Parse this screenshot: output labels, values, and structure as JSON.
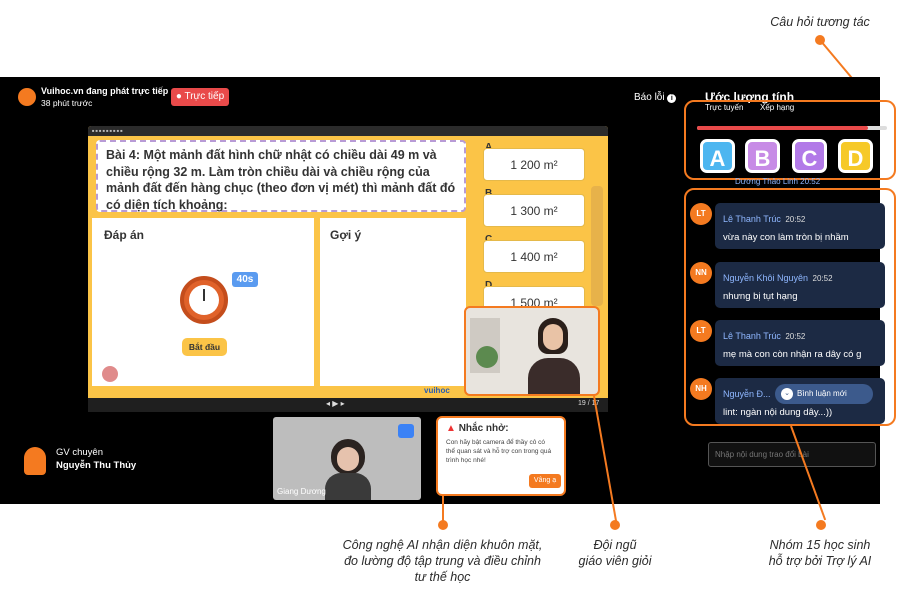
{
  "callouts": {
    "top_right": "Câu hỏi tương tác",
    "bottom_left": [
      "Công nghệ AI nhận diện khuôn mặt,",
      "đo lường độ tập trung và điều chỉnh",
      "tư thế học"
    ],
    "bottom_mid": [
      "Đội ngũ",
      "giáo viên giỏi"
    ],
    "bottom_right": [
      "Nhóm 15 học sinh",
      "hỗ trợ bởi Trợ lý AI"
    ]
  },
  "header": {
    "channel": "Vuihoc.vn đang phát trực tiếp",
    "time_ago": "38 phút trước",
    "live_label": "Trực tiếp",
    "report_label": "Báo lỗi",
    "panel_title": "Ước lượng tính"
  },
  "slide": {
    "question": "Bài 4: Một mảnh đất hình chữ nhật có chiều dài 49 m và chiều rộng 32 m. Làm tròn chiều dài và chiều rộng của mảnh đất đến hàng chục (theo đơn vị mét) thì mảnh đất đó có diện tích khoảng:",
    "answers": [
      {
        "letter": "A",
        "value": "1 200 m²"
      },
      {
        "letter": "B",
        "value": "1 300 m²"
      },
      {
        "letter": "C",
        "value": "1 400 m²"
      },
      {
        "letter": "D",
        "value": "1 500 m²"
      }
    ],
    "answer_panel_title": "Đáp án",
    "hint_panel_title": "Gợi ý",
    "timer": "40s",
    "start_label": "Bắt đầu",
    "logo": "vuihoc",
    "page": "19 / 17"
  },
  "teacher": {
    "role": "GV chuyên",
    "name": "Nguyễn Thu Thủy"
  },
  "student_cam": {
    "name": "Giang Dương"
  },
  "reminder": {
    "title": "Nhắc nhở:",
    "body": "Con hãy bật camera để thầy cô có thể quan sát và hỗ trợ con trong quá trình học nhé!",
    "ok_label": "Vâng ạ"
  },
  "right_panel": {
    "tabs": [
      "Trực tuyến",
      "Xếp hạng"
    ],
    "progress": 0.9,
    "choices": [
      {
        "label": "A",
        "color": "#4db6f0"
      },
      {
        "label": "B",
        "color": "#c78be6"
      },
      {
        "label": "C",
        "color": "#b27ae8"
      },
      {
        "label": "D",
        "color": "#f6c928"
      }
    ],
    "partial_msg": "Dương Thảo Linh 20:52",
    "messages": [
      {
        "initials": "LT",
        "name": "Lê Thanh Trúc",
        "time": "20:52",
        "text": "vừa này con làm tròn bị nhầm"
      },
      {
        "initials": "NN",
        "name": "Nguyễn Khôi Nguyên",
        "time": "20:52",
        "text": "nhưng bị tụt hạng"
      },
      {
        "initials": "LT",
        "name": "Lê Thanh Trúc",
        "time": "20:52",
        "text": "mẹ mà con còn nhận ra dây có g"
      },
      {
        "initials": "NH",
        "name": "Nguyễn Đ...",
        "time": "",
        "text": "lint: ngàn nội dung dây...))"
      }
    ],
    "new_msg_label": "Bình luận mới",
    "input_placeholder": "Nhập nội dung trao đổi bài"
  }
}
